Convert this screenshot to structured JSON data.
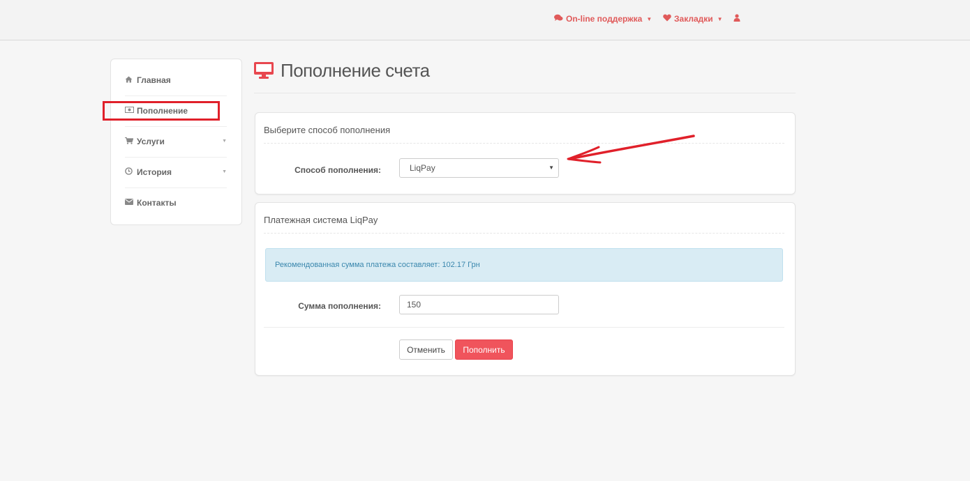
{
  "topbar": {
    "support": "On-line поддержка",
    "bookmarks": "Закладки",
    "support_icon": "comments-icon",
    "bookmarks_icon": "heart-icon",
    "user_icon": "user-icon"
  },
  "sidebar": {
    "items": [
      {
        "label": "Главная",
        "icon": "home-icon"
      },
      {
        "label": "Пополнение",
        "icon": "money-icon"
      },
      {
        "label": "Услуги",
        "icon": "cart-icon"
      },
      {
        "label": "История",
        "icon": "clock-icon"
      },
      {
        "label": "Контакты",
        "icon": "envelope-icon"
      }
    ]
  },
  "page": {
    "title": "Пополнение счета",
    "title_icon": "monitor-icon"
  },
  "method_panel": {
    "heading": "Выберите способ пополнения",
    "label": "Способ пополнения:",
    "selected": "LiqPay"
  },
  "payment_panel": {
    "heading": "Платежная система LiqPay",
    "alert": "Рекомендованная сумма платежа составляет: 102.17 Грн",
    "amount_label": "Сумма пополнения:",
    "amount_value": "150",
    "cancel_label": "Отменить",
    "submit_label": "Пополнить"
  },
  "colors": {
    "accent": "#f0545c",
    "annotation": "#e0202a",
    "alert_bg": "#d9ecf4",
    "alert_text": "#3a87ad"
  }
}
